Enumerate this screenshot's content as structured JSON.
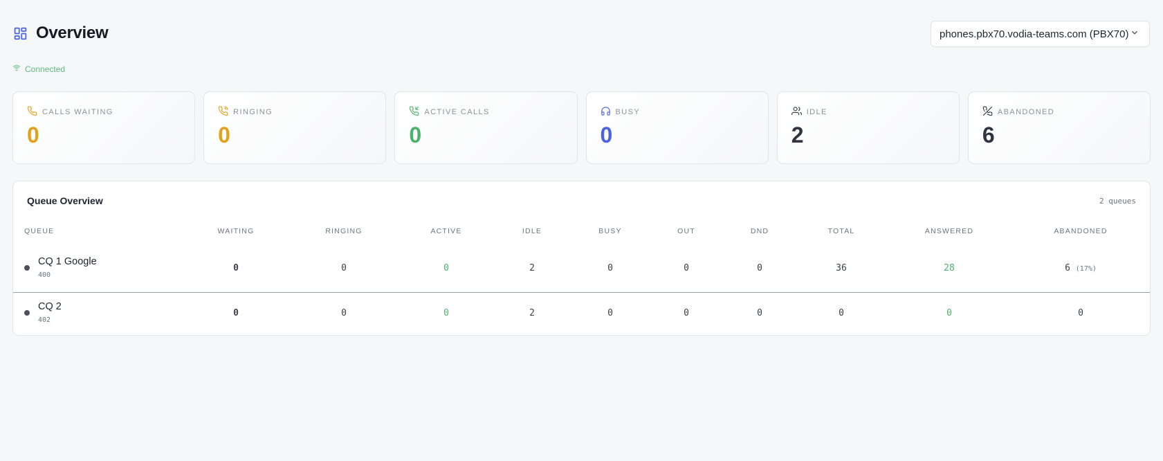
{
  "header": {
    "title": "Overview",
    "server_select": "phones.pbx70.vodia-teams.com (PBX70)"
  },
  "status": {
    "label": "Connected",
    "color": "#5fb97d"
  },
  "cards": [
    {
      "label": "Calls Waiting",
      "value": "0",
      "color": "#e2a11b",
      "icon": "phone-icon"
    },
    {
      "label": "Ringing",
      "value": "0",
      "color": "#e2a11b",
      "icon": "phone-ringing-icon"
    },
    {
      "label": "Active Calls",
      "value": "0",
      "color": "#4cb36c",
      "icon": "phone-active-icon"
    },
    {
      "label": "Busy",
      "value": "0",
      "color": "#4b63e0",
      "icon": "headset-icon"
    },
    {
      "label": "Idle",
      "value": "2",
      "color": "#2f3440",
      "icon": "users-icon"
    },
    {
      "label": "Abandoned",
      "value": "6",
      "color": "#2f3440",
      "icon": "phone-off-icon"
    }
  ],
  "queue_panel": {
    "title": "Queue Overview",
    "count": "2 queues",
    "columns": [
      "Queue",
      "Waiting",
      "Ringing",
      "Active",
      "Idle",
      "Busy",
      "Out",
      "DND",
      "Total",
      "Answered",
      "Abandoned"
    ],
    "rows": [
      {
        "name": "CQ 1 Google",
        "ext": "400",
        "waiting": "0",
        "ringing": "0",
        "active": "0",
        "idle": "2",
        "busy": "0",
        "out": "0",
        "dnd": "0",
        "total": "36",
        "answered": "28",
        "abandoned": "6",
        "abandoned_pct": "(17%)"
      },
      {
        "name": "CQ 2",
        "ext": "402",
        "waiting": "0",
        "ringing": "0",
        "active": "0",
        "idle": "2",
        "busy": "0",
        "out": "0",
        "dnd": "0",
        "total": "0",
        "answered": "0",
        "abandoned": "0",
        "abandoned_pct": ""
      }
    ]
  },
  "colors": {
    "accent_blue": "#4b63e0",
    "accent_orange": "#e2a11b",
    "accent_green": "#4cb36c"
  }
}
